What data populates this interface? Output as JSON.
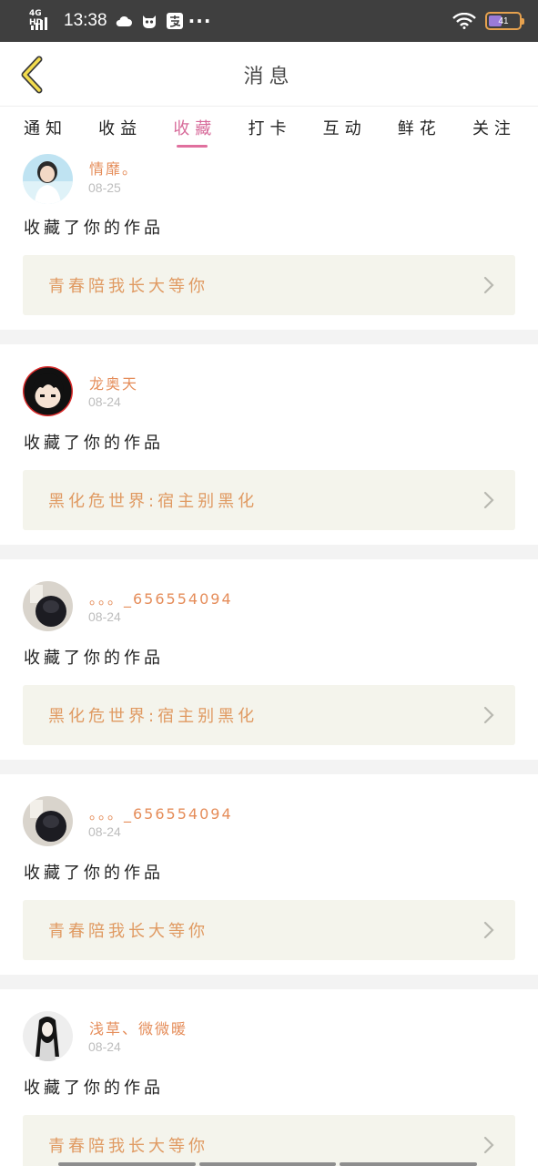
{
  "status_bar": {
    "network": "4G HD",
    "time": "13:38",
    "battery": "41",
    "icons": [
      "cloud-icon",
      "cat-icon",
      "alipay-icon",
      "more-dots-icon",
      "wifi-icon",
      "battery-icon"
    ]
  },
  "header": {
    "title": "消息",
    "back_icon": "chevron-left-icon"
  },
  "tabs": [
    {
      "label": "通知",
      "active": false
    },
    {
      "label": "收益",
      "active": false
    },
    {
      "label": "收藏",
      "active": true
    },
    {
      "label": "打卡",
      "active": false
    },
    {
      "label": "互动",
      "active": false
    },
    {
      "label": "鲜花",
      "active": false
    },
    {
      "label": "关注",
      "active": false
    }
  ],
  "notifications": [
    {
      "name": "情靡。",
      "date": "08-25",
      "action": "收藏了你的作品",
      "work": "青春陪我长大等你"
    },
    {
      "name": "龙奥天",
      "date": "08-24",
      "action": "收藏了你的作品",
      "work": "黑化危世界:宿主别黑化"
    },
    {
      "name": "。。。_656554094",
      "date": "08-24",
      "action": "收藏了你的作品",
      "work": "黑化危世界:宿主别黑化"
    },
    {
      "name": "。。。_656554094",
      "date": "08-24",
      "action": "收藏了你的作品",
      "work": "青春陪我长大等你"
    },
    {
      "name": "浅草、微微暖",
      "date": "08-24",
      "action": "收藏了你的作品",
      "work": "青春陪我长大等你"
    }
  ],
  "colors": {
    "accent": "#e0709e",
    "name": "#e58d5a",
    "work_title": "#e09a62",
    "work_bg": "#f4f4ec",
    "status_bar_bg": "#3f3f3f"
  }
}
